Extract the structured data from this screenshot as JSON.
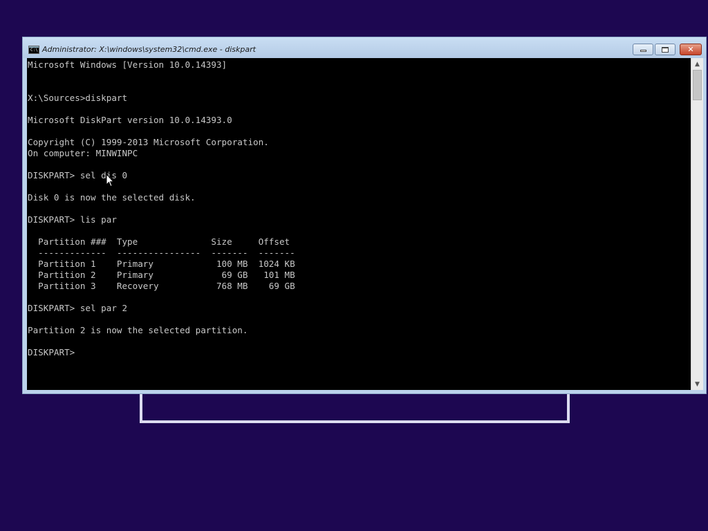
{
  "window": {
    "title": "Administrator: X:\\windows\\system32\\cmd.exe - diskpart",
    "icon": "cmd-icon",
    "icon_label": "C:\\",
    "minimize_icon": "minimize-icon",
    "maximize_icon": "maximize-icon",
    "close_icon": "close-icon"
  },
  "console": {
    "lines": [
      "Microsoft Windows [Version 10.0.14393]",
      "",
      "",
      "X:\\Sources>diskpart",
      "",
      "Microsoft DiskPart version 10.0.14393.0",
      "",
      "Copyright (C) 1999-2013 Microsoft Corporation.",
      "On computer: MINWINPC",
      "",
      "DISKPART> sel dis 0",
      "",
      "Disk 0 is now the selected disk.",
      "",
      "DISKPART> lis par",
      "",
      "  Partition ###  Type              Size     Offset",
      "  -------------  ----------------  -------  -------",
      "  Partition 1    Primary            100 MB  1024 KB",
      "  Partition 2    Primary             69 GB   101 MB",
      "  Partition 3    Recovery           768 MB    69 GB",
      "",
      "DISKPART> sel par 2",
      "",
      "Partition 2 is now the selected partition.",
      "",
      "DISKPART> "
    ]
  },
  "scrollbar": {
    "up_icon": "scroll-up-arrow-icon",
    "down_icon": "scroll-down-arrow-icon"
  },
  "colors": {
    "desktop": "#1d0751",
    "console_bg": "#000000",
    "console_fg": "#c8c8c8",
    "titlebar": "#bcd3ec",
    "close_button": "#c7452a"
  }
}
